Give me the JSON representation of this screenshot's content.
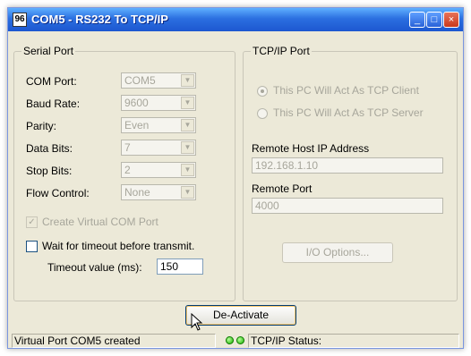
{
  "window": {
    "title": "COM5 - RS232 To TCP/IP",
    "icon_text": "96",
    "buttons": {
      "minimize": "_",
      "maximize": "□",
      "close": "×"
    }
  },
  "serial": {
    "legend": "Serial Port",
    "com_port": {
      "label": "COM Port:",
      "value": "COM5"
    },
    "baud_rate": {
      "label": "Baud Rate:",
      "value": "9600"
    },
    "parity": {
      "label": "Parity:",
      "value": "Even"
    },
    "data_bits": {
      "label": "Data Bits:",
      "value": "7"
    },
    "stop_bits": {
      "label": "Stop Bits:",
      "value": "2"
    },
    "flow_control": {
      "label": "Flow Control:",
      "value": "None"
    },
    "create_virtual": {
      "label": "Create Virtual COM Port",
      "checked": true,
      "mark": "✓"
    },
    "wait_timeout": {
      "label": "Wait for timeout before transmit.",
      "checked": false
    },
    "timeout_value": {
      "label": "Timeout value (ms):",
      "value": "150"
    }
  },
  "tcp": {
    "legend": "TCP/IP Port",
    "client_radio": {
      "label": "This PC Will Act As TCP Client",
      "selected": true
    },
    "server_radio": {
      "label": "This PC Will Act As TCP Server",
      "selected": false
    },
    "remote_host": {
      "label": "Remote Host IP Address",
      "value": "192.168.1.10"
    },
    "remote_port": {
      "label": "Remote Port",
      "value": "4000"
    },
    "io_options_label": "I/O Options..."
  },
  "deactivate_label": "De-Activate",
  "status": {
    "message": "Virtual Port COM5 created",
    "tcp_status": "TCP/IP Status:"
  }
}
